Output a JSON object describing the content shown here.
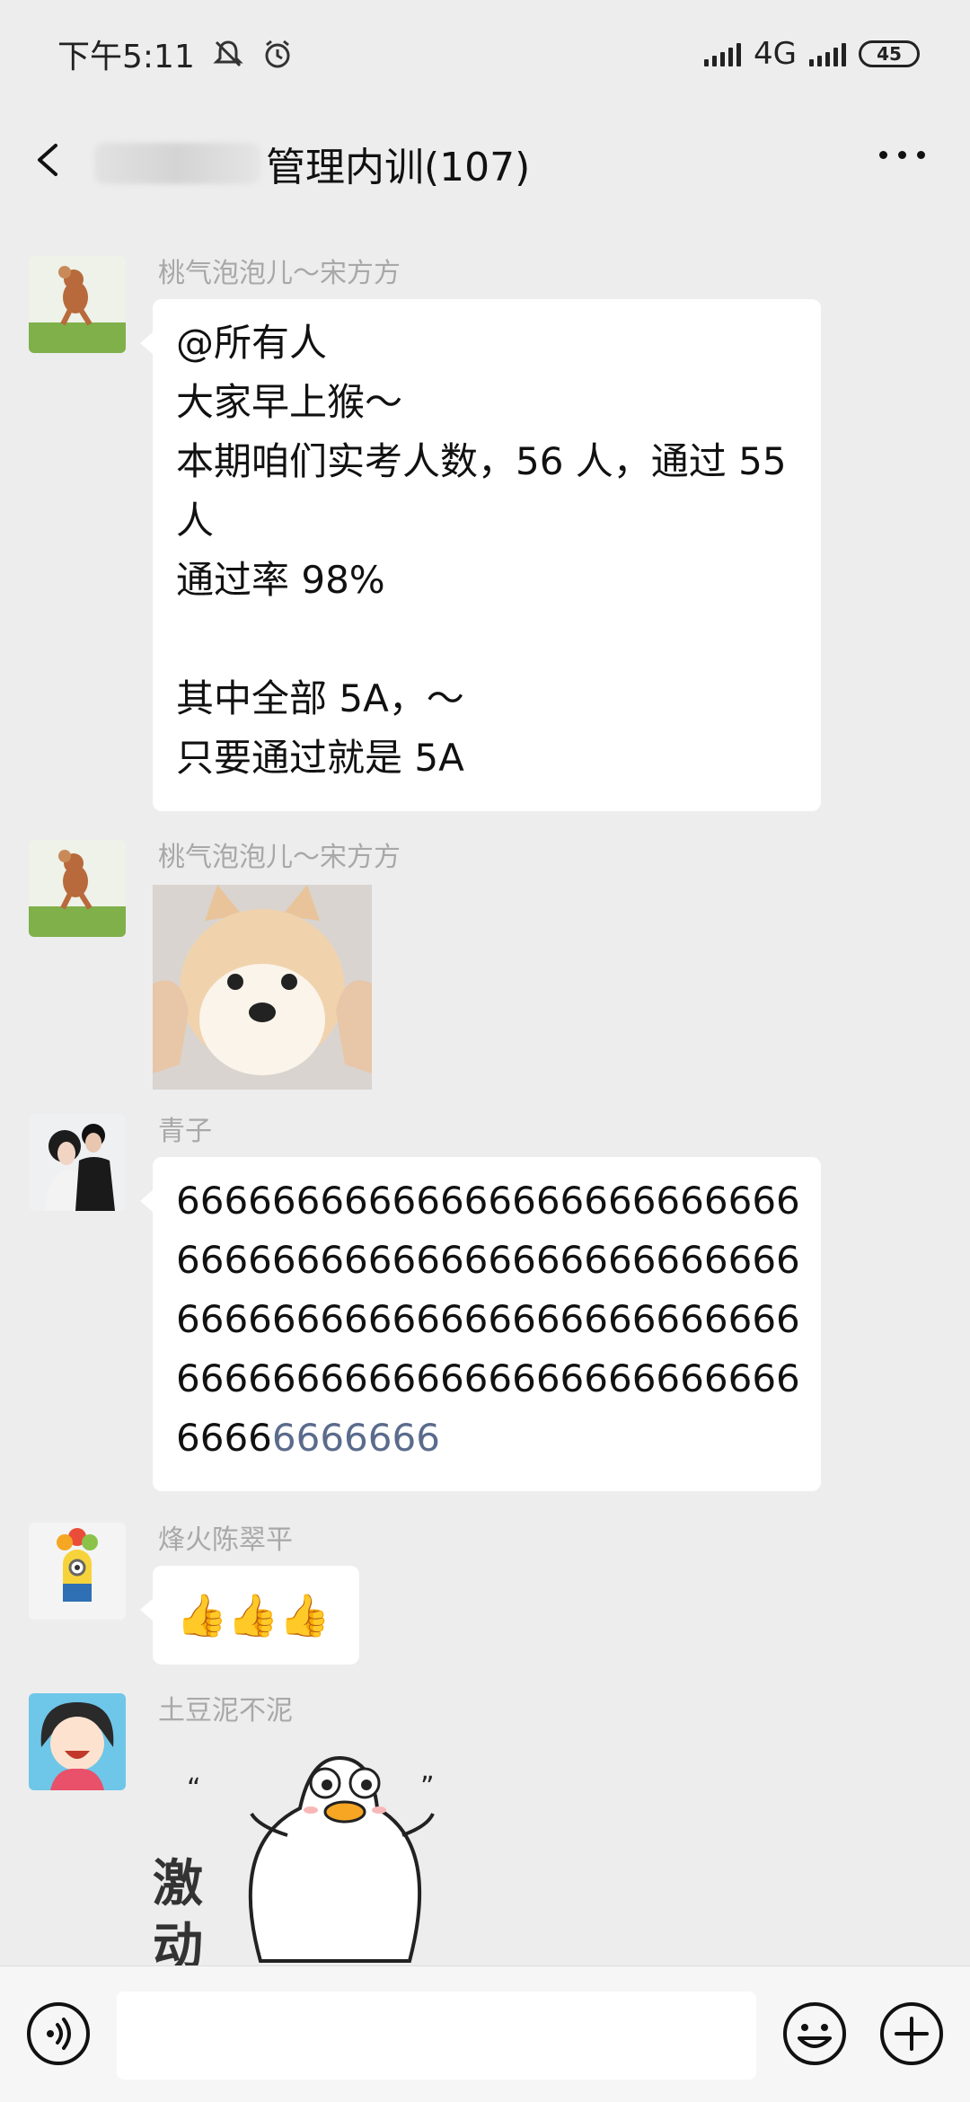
{
  "status_bar": {
    "time": "下午5:11",
    "network": "4G",
    "battery": "45",
    "icons": [
      "mute-bell-icon",
      "alarm-icon",
      "signal-icon",
      "battery-icon"
    ]
  },
  "header": {
    "title_visible": "管理内训(107)",
    "icons": [
      "back-arrow-icon",
      "more-dots-icon"
    ]
  },
  "messages": [
    {
      "sender": "桃气泡泡儿～宋方方",
      "avatar": "cartoon-mouse-avatar",
      "lines": [
        "@所有人",
        "大家早上猴～",
        "本期咱们实考人数，56 人，通过 55",
        "人",
        "通过率 98%",
        "",
        "其中全部 5A，～",
        "只要通过就是 5A"
      ]
    },
    {
      "sender": "桃气泡泡儿～宋方方",
      "avatar": "cartoon-mouse-avatar",
      "image": "shiba-dog-sticker"
    },
    {
      "sender": "青子",
      "avatar": "couple-photo-avatar",
      "lines": [
        "66666666666666666666666666",
        "66666666666666666666666666",
        "66666666666666666666666666",
        "66666666666666666666666666"
      ],
      "last_line_plain": "6666",
      "last_line_link": "6666666"
    },
    {
      "sender": "烽火陈翠平",
      "avatar": "minion-avatar",
      "thumbs": "👍👍👍"
    },
    {
      "sender": "土豆泥不泥",
      "avatar": "cartoon-girl-avatar",
      "sticker_text": "激动",
      "image": "duck-sticker"
    }
  ],
  "input_bar": {
    "icons": [
      "voice-icon",
      "emoji-icon",
      "plus-icon"
    ],
    "input_value": ""
  }
}
